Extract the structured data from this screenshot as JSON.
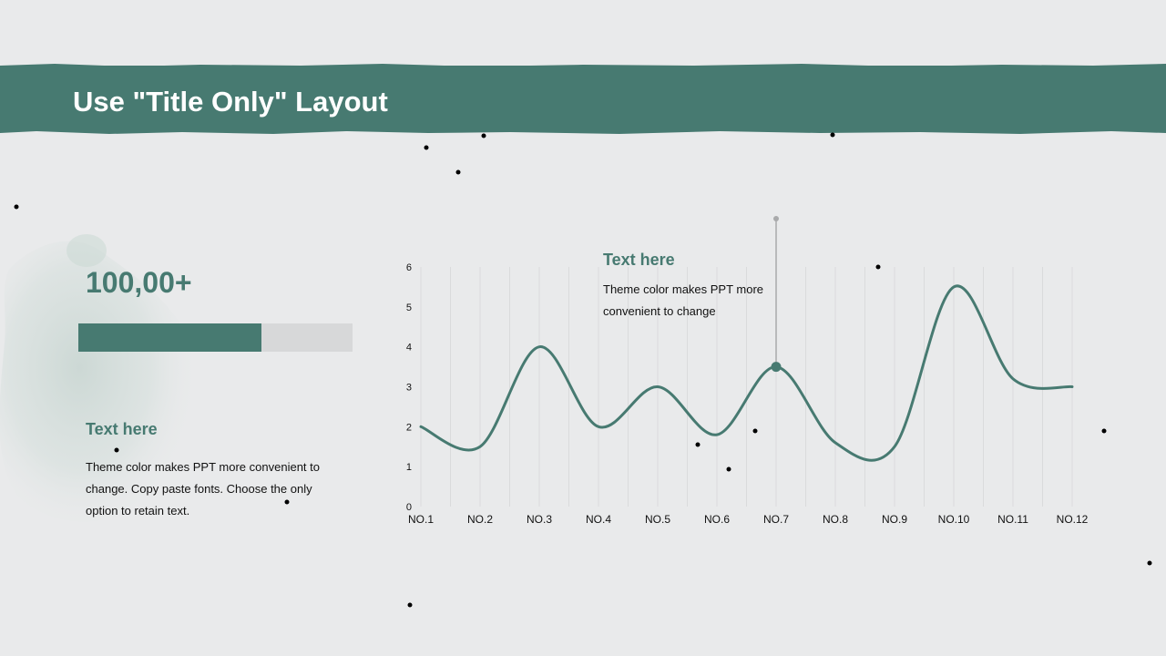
{
  "slide": {
    "title": "Use \"Title Only\" Layout"
  },
  "left_panel": {
    "big_number": "100,00+",
    "progress_fraction": 0.667,
    "heading": "Text here",
    "body": "Theme color makes PPT more convenient  to change. Copy paste fonts. Choose the only option to retain text."
  },
  "chart_callout": {
    "heading": "Text here",
    "body": "Theme color makes PPT more convenient  to change"
  },
  "colors": {
    "accent": "#477a71",
    "background": "#e9eaeb",
    "track": "#d7d8d9"
  },
  "chart_data": {
    "type": "line",
    "smooth": true,
    "categories": [
      "NO.1",
      "NO.2",
      "NO.3",
      "NO.4",
      "NO.5",
      "NO.6",
      "NO.7",
      "NO.8",
      "NO.9",
      "NO.10",
      "NO.11",
      "NO.12"
    ],
    "values": [
      2,
      1.5,
      4,
      2,
      3,
      1.8,
      3.5,
      1.6,
      1.5,
      5.5,
      3.2,
      3
    ],
    "yticks": [
      0,
      1,
      2,
      3,
      4,
      5,
      6
    ],
    "ylim": [
      0,
      6
    ],
    "grid": "vertical",
    "highlight_index": 6,
    "title": "",
    "xlabel": "",
    "ylabel": ""
  }
}
